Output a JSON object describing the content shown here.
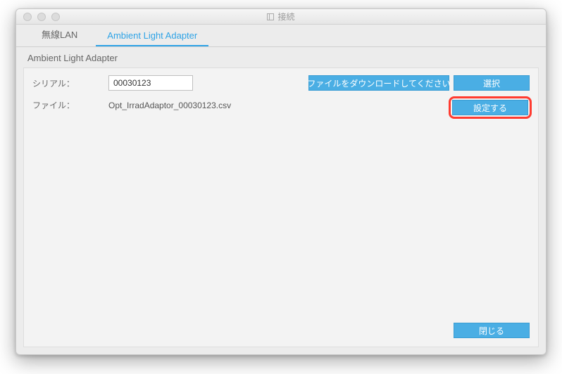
{
  "window": {
    "title": "接続"
  },
  "tabs": [
    {
      "label": "無線LAN",
      "active": false
    },
    {
      "label": "Ambient Light Adapter",
      "active": true
    }
  ],
  "section": {
    "title": "Ambient Light Adapter"
  },
  "fields": {
    "serial": {
      "label": "シリアル：",
      "value": "00030123"
    },
    "file": {
      "label": "ファイル：",
      "value": "Opt_IrradAdaptor_00030123.csv"
    }
  },
  "buttons": {
    "download": "ファイルをダウンロードしてください",
    "select": "選択",
    "set": "設定する",
    "close": "閉じる"
  }
}
